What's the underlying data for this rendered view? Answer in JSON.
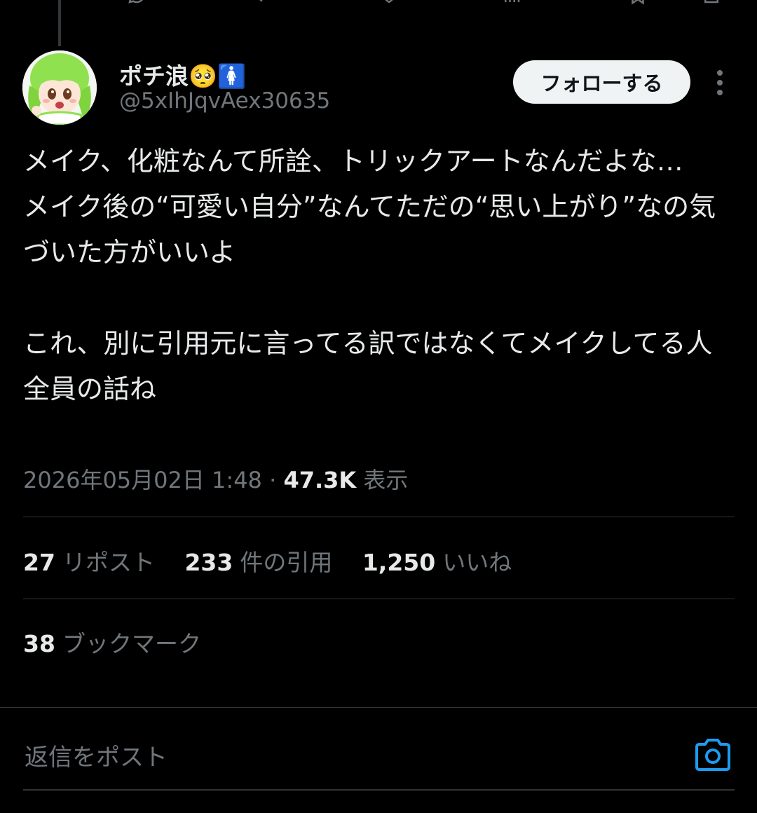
{
  "post": {
    "display_name": "ポチ浪🥺🚺",
    "handle": "@5xIhJqvAex30635",
    "follow_label": "フォローする",
    "body": "メイク、化粧なんて所詮、トリックアートなんだよな…\nメイク後の“可愛い自分”なんてただの“思い上がり”なの気づいた方がいいよ\n\nこれ、別に引用元に言ってる訳ではなくてメイクしてる人全員の話ね",
    "timestamp": "2026年05月02日 1:48",
    "separator": "·",
    "views_count": "47.3K",
    "views_label": "表示"
  },
  "stats": {
    "reposts_count": "27",
    "reposts_label": "リポスト",
    "quotes_count": "233",
    "quotes_label": "件の引用",
    "likes_count": "1,250",
    "likes_label": "いいね",
    "bookmarks_count": "38",
    "bookmarks_label": "ブックマーク"
  },
  "reply": {
    "placeholder": "返信をポスト"
  },
  "icons": {
    "more": "more-vertical-icon",
    "camera": "camera-icon",
    "avatar": "anime-character-avatar"
  },
  "colors": {
    "background": "#000000",
    "text": "#e7e9ea",
    "muted": "#71767b",
    "accent": "#1d9bf0",
    "follow_bg": "#eff3f4"
  }
}
